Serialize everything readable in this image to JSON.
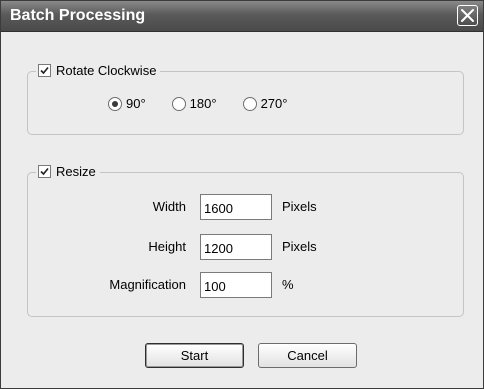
{
  "window": {
    "title": "Batch Processing"
  },
  "rotate": {
    "label": "Rotate Clockwise",
    "checked": true,
    "options": [
      {
        "label": "90°",
        "selected": true
      },
      {
        "label": "180°",
        "selected": false
      },
      {
        "label": "270°",
        "selected": false
      }
    ]
  },
  "resize": {
    "label": "Resize",
    "checked": true,
    "width": {
      "label": "Width",
      "value": "1600",
      "unit": "Pixels"
    },
    "height": {
      "label": "Height",
      "value": "1200",
      "unit": "Pixels"
    },
    "magnification": {
      "label": "Magnification",
      "value": "100",
      "unit": "%"
    }
  },
  "buttons": {
    "start": "Start",
    "cancel": "Cancel"
  }
}
